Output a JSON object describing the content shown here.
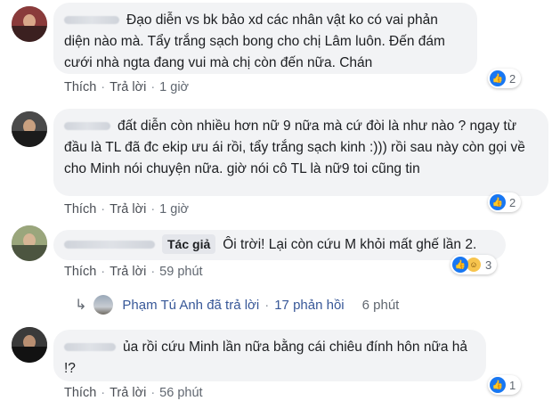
{
  "comments": [
    {
      "text": "Đạo diễn vs bk bảo xd các nhân vật ko có vai phản diện nào mà. Tẩy trắng sạch bong cho chị Lâm luôn. Đến đám cưới nhà ngta đang vui mà chị còn đến nữa. Chán",
      "author_badge": "",
      "like_label": "Thích",
      "reply_label": "Trả lời",
      "time": "1 giờ",
      "reaction_count": "2"
    },
    {
      "text": "đất diễn còn nhiều hơn nữ 9 nữa mà cứ đòi là như nào ? ngay từ đầu là TL đã đc ekip ưu ái rồi, tẩy trắng sạch kinh :))) rồi sau này còn gọi về cho Minh nói chuyện nữa. giờ nói cô TL là nữ9 toi cũng tin",
      "author_badge": "",
      "like_label": "Thích",
      "reply_label": "Trả lời",
      "time": "1 giờ",
      "reaction_count": "2"
    },
    {
      "text": "Ôi trời! Lại còn cứu M khỏi mất ghế lần 2.",
      "author_badge": "Tác giả",
      "like_label": "Thích",
      "reply_label": "Trả lời",
      "time": "59 phút",
      "reaction_count": "3"
    },
    {
      "text": "ủa rồi cứu Minh lần nữa bằng cái chiêu đính hôn nữa hả !?",
      "author_badge": "",
      "like_label": "Thích",
      "reply_label": "Trả lời",
      "time": "56 phút",
      "reaction_count": "1"
    }
  ],
  "reply_summary": {
    "text": "Phạm Tú Anh đã trả lời",
    "count": "17 phản hồi",
    "time": "6 phút"
  },
  "colors": {
    "bubble": "#f2f3f5",
    "like_blue": "#1877f2",
    "link": "#385898",
    "meta": "#606770"
  }
}
